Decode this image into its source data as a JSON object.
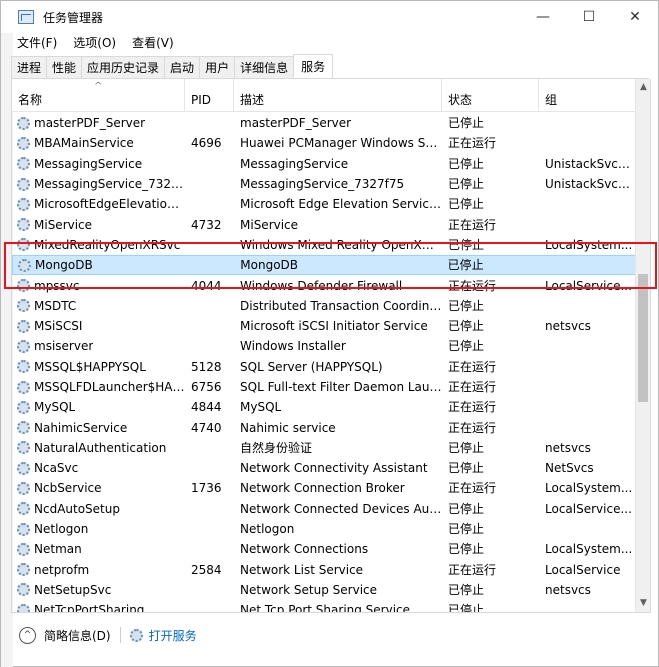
{
  "window": {
    "title": "任务管理器",
    "controls": {
      "minimize": "—",
      "maximize": "☐",
      "close": "✕"
    }
  },
  "menu": [
    "文件(F)",
    "选项(O)",
    "查看(V)"
  ],
  "tabs": [
    {
      "label": "进程",
      "active": false
    },
    {
      "label": "性能",
      "active": false
    },
    {
      "label": "应用历史记录",
      "active": false
    },
    {
      "label": "启动",
      "active": false
    },
    {
      "label": "用户",
      "active": false
    },
    {
      "label": "详细信息",
      "active": false
    },
    {
      "label": "服务",
      "active": true
    }
  ],
  "table": {
    "columns": [
      "名称",
      "PID",
      "描述",
      "状态",
      "组"
    ],
    "sort_indicator": "^",
    "rows": [
      {
        "name": "masterPDF_Server",
        "pid": "",
        "desc": "masterPDF_Server",
        "status": "已停止",
        "group": ""
      },
      {
        "name": "MBAMainService",
        "pid": "4696",
        "desc": "Huawei PCManager Windows Se...",
        "status": "正在运行",
        "group": ""
      },
      {
        "name": "MessagingService",
        "pid": "",
        "desc": "MessagingService",
        "status": "已停止",
        "group": "UnistackSvcG..."
      },
      {
        "name": "MessagingService_7327f...",
        "pid": "",
        "desc": "MessagingService_7327f75",
        "status": "已停止",
        "group": "UnistackSvcG..."
      },
      {
        "name": "MicrosoftEdgeElevationS...",
        "pid": "",
        "desc": "Microsoft Edge Elevation Service...",
        "status": "已停止",
        "group": ""
      },
      {
        "name": "MiService",
        "pid": "4732",
        "desc": "MiService",
        "status": "正在运行",
        "group": ""
      },
      {
        "name": "MixedRealityOpenXRSvc",
        "pid": "",
        "desc": "Windows Mixed Reality OpenXR ...",
        "status": "已停止",
        "group": "LocalSystem..."
      },
      {
        "name": "MongoDB",
        "pid": "",
        "desc": "MongoDB",
        "status": "已停止",
        "group": "",
        "selected": true
      },
      {
        "name": "mpssvc",
        "pid": "4044",
        "desc": "Windows Defender Firewall",
        "status": "正在运行",
        "group": "LocalService..."
      },
      {
        "name": "MSDTC",
        "pid": "",
        "desc": "Distributed Transaction Coordina...",
        "status": "已停止",
        "group": ""
      },
      {
        "name": "MSiSCSI",
        "pid": "",
        "desc": "Microsoft iSCSI Initiator Service",
        "status": "已停止",
        "group": "netsvcs"
      },
      {
        "name": "msiserver",
        "pid": "",
        "desc": "Windows Installer",
        "status": "已停止",
        "group": ""
      },
      {
        "name": "MSSQL$HAPPYSQL",
        "pid": "5128",
        "desc": "SQL Server (HAPPYSQL)",
        "status": "正在运行",
        "group": ""
      },
      {
        "name": "MSSQLFDLauncher$HAP...",
        "pid": "6756",
        "desc": "SQL Full-text Filter Daemon Laun...",
        "status": "正在运行",
        "group": ""
      },
      {
        "name": "MySQL",
        "pid": "4844",
        "desc": "MySQL",
        "status": "正在运行",
        "group": ""
      },
      {
        "name": "NahimicService",
        "pid": "4740",
        "desc": "Nahimic service",
        "status": "正在运行",
        "group": ""
      },
      {
        "name": "NaturalAuthentication",
        "pid": "",
        "desc": "自然身份验证",
        "status": "已停止",
        "group": "netsvcs"
      },
      {
        "name": "NcaSvc",
        "pid": "",
        "desc": "Network Connectivity Assistant",
        "status": "已停止",
        "group": "NetSvcs"
      },
      {
        "name": "NcbService",
        "pid": "1736",
        "desc": "Network Connection Broker",
        "status": "正在运行",
        "group": "LocalSystem..."
      },
      {
        "name": "NcdAutoSetup",
        "pid": "",
        "desc": "Network Connected Devices Aut...",
        "status": "已停止",
        "group": "LocalService..."
      },
      {
        "name": "Netlogon",
        "pid": "",
        "desc": "Netlogon",
        "status": "已停止",
        "group": ""
      },
      {
        "name": "Netman",
        "pid": "",
        "desc": "Network Connections",
        "status": "已停止",
        "group": "LocalSystem..."
      },
      {
        "name": "netprofm",
        "pid": "2584",
        "desc": "Network List Service",
        "status": "正在运行",
        "group": "LocalService"
      },
      {
        "name": "NetSetupSvc",
        "pid": "",
        "desc": "Network Setup Service",
        "status": "已停止",
        "group": "netsvcs"
      },
      {
        "name": "NetTcpPortSharing",
        "pid": "",
        "desc": "Net.Tcp Port Sharing Service",
        "status": "已停止",
        "group": ""
      }
    ]
  },
  "scrollbar": {
    "up": "▲",
    "down": "▼"
  },
  "footer": {
    "chevron": "^",
    "summary_label": "简略信息(D)",
    "open_services_label": "打开服务"
  },
  "highlight_color": "#e8141b",
  "accent_selected": "#cce8ff"
}
